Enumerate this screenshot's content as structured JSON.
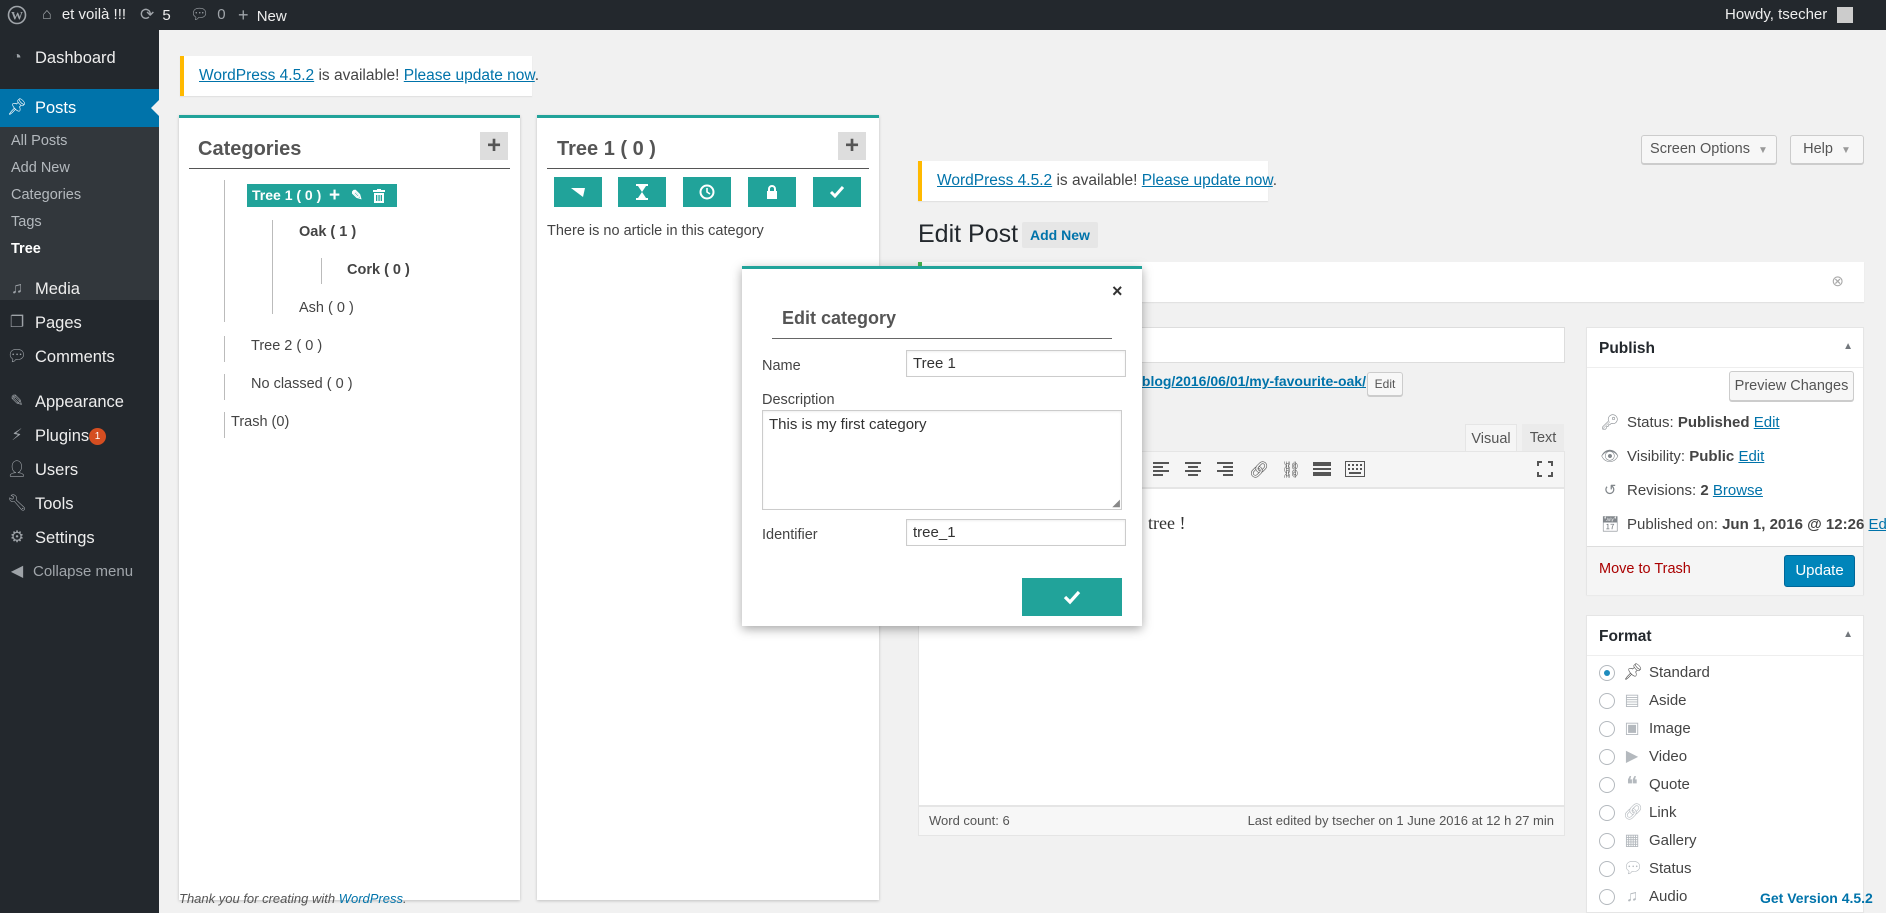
{
  "admin_bar": {
    "site_name": "et voilà !!!",
    "updates_count": "5",
    "comments_count": "0",
    "new_label": "New",
    "greeting": "Howdy, tsecher"
  },
  "sidebar": {
    "dashboard": "Dashboard",
    "posts": "Posts",
    "posts_sub": [
      "All Posts",
      "Add New",
      "Categories",
      "Tags",
      "Tree"
    ],
    "media": "Media",
    "pages": "Pages",
    "comments": "Comments",
    "appearance": "Appearance",
    "plugins": "Plugins",
    "plugins_badge": "1",
    "users": "Users",
    "tools": "Tools",
    "settings": "Settings",
    "collapse": "Collapse menu"
  },
  "notice_top": {
    "link": "WordPress 4.5.2",
    "text": " is available! ",
    "update_link": "Please update now",
    "end": "."
  },
  "categories_panel": {
    "title": "Categories",
    "selected_node": "Tree 1 ( 0 )",
    "nodes": [
      "Oak ( 1 )",
      "Cork ( 0 )",
      "Ash ( 0 )",
      "Tree 2 ( 0 )",
      "No classed ( 0 )",
      "Trash (0)"
    ]
  },
  "tree_panel": {
    "title": "Tree 1 ( 0 )",
    "empty_text": "There is no article in this category"
  },
  "edit_post": {
    "screen_options": "Screen Options",
    "help": "Help",
    "title": "Edit Post",
    "add_new": "Add New",
    "permalink_tail": "/blog/2016/06/01/my-favourite-oak/",
    "permalink_edit": "Edit",
    "tab_visual": "Visual",
    "tab_text": "Text",
    "content_fragment": "tree !",
    "word_count": "Word count: 6",
    "last_edited": "Last edited by tsecher on 1 June 2016 at 12 h 27 min",
    "footer_text": "Thank you for creating with ",
    "footer_link": "WordPress",
    "footer_end": ".",
    "version": "Get Version 4.5.2"
  },
  "publish_box": {
    "title": "Publish",
    "preview": "Preview Changes",
    "status_label": "Status: ",
    "status_value": "Published",
    "visibility_label": "Visibility: ",
    "visibility_value": "Public",
    "revisions_label": "Revisions: ",
    "revisions_value": "2",
    "browse": "Browse",
    "published_label": "Published on: ",
    "published_value": "Jun 1, 2016 @ 12:26",
    "edit": "Edit",
    "trash": "Move to Trash",
    "update": "Update"
  },
  "format_box": {
    "title": "Format",
    "options": [
      "Standard",
      "Aside",
      "Image",
      "Video",
      "Quote",
      "Link",
      "Gallery",
      "Status",
      "Audio"
    ],
    "selected": "Standard"
  },
  "modal": {
    "title": "Edit category",
    "name_label": "Name",
    "name_value": "Tree 1",
    "description_label": "Description",
    "description_value": "This is my first category",
    "identifier_label": "Identifier",
    "identifier_value": "tree_1"
  },
  "colors": {
    "accent_teal": "#21a39a",
    "wp_blue": "#0073aa",
    "admin_dark": "#23282d",
    "notice_yellow": "#ffb900",
    "badge_orange": "#d54e21",
    "trash_red": "#a00"
  }
}
